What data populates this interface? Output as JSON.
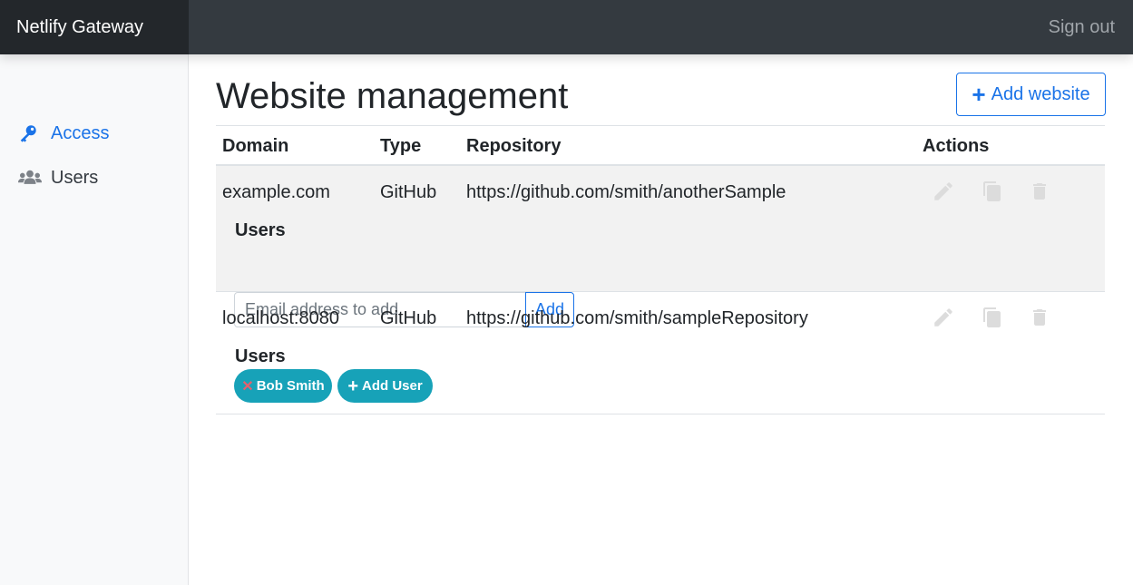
{
  "app": {
    "brand": "Netlify Gateway",
    "sign_out": "Sign out"
  },
  "sidebar": {
    "items": [
      {
        "label": "Access",
        "icon": "key-icon",
        "active": true
      },
      {
        "label": "Users",
        "icon": "users-icon",
        "active": false
      }
    ]
  },
  "main": {
    "title": "Website management",
    "add_website_label": "Add website",
    "table": {
      "headers": [
        "Domain",
        "Type",
        "Repository",
        "Actions"
      ],
      "rows": [
        {
          "domain": "example.com",
          "type": "GitHub",
          "repository": "https://github.com/smith/anotherSample",
          "users_label": "Users",
          "email_placeholder": "Email address to add",
          "add_label": "Add"
        },
        {
          "domain": "localhost:8080",
          "type": "GitHub",
          "repository": "https://github.com/smith/sampleRepository",
          "users_label": "Users",
          "users": [
            "Bob Smith"
          ],
          "add_user_label": "Add User"
        }
      ]
    }
  },
  "colors": {
    "topbar": "#343a40",
    "brand_bg": "#23272b",
    "accent": "#1a73e8",
    "pill": "#17a2b8",
    "remove_x": "#e4606d",
    "action_icon": "#dcdcdc"
  }
}
